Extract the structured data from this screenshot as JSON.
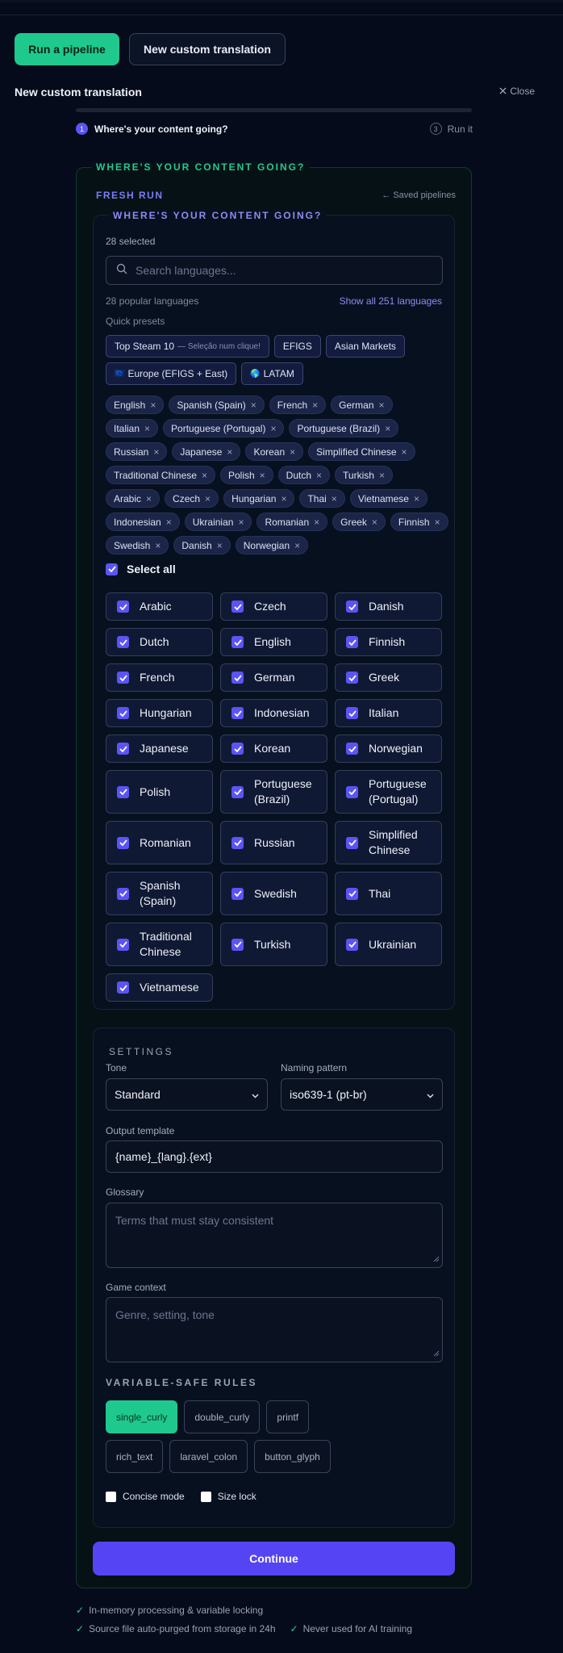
{
  "tabs": {
    "primary_label": "Run a pipeline",
    "secondary_label": "New custom translation"
  },
  "header": {
    "title": "New custom translation",
    "close_label": "Close"
  },
  "progress": {
    "fraction": 0
  },
  "steps": [
    {
      "number": "1",
      "label": "Where's your content going?",
      "active": true
    },
    {
      "number": "3",
      "label": "Run it",
      "active": false
    }
  ],
  "panel": {
    "legend": "WHERE'S YOUR CONTENT GOING?",
    "fresh_run": "FRESH RUN",
    "saved_link": "← Saved pipelines"
  },
  "languages": {
    "legend": "WHERE'S YOUR CONTENT GOING?",
    "selected_count": "28 selected",
    "search_placeholder": "Search languages...",
    "popular_count": "28 popular languages",
    "show_all": "Show all 251 languages",
    "quick_presets_label": "Quick presets",
    "presets": [
      {
        "label": "Top Steam 10",
        "sub": "— Seleção num clique!"
      },
      {
        "label": "EFIGS",
        "sub": ""
      },
      {
        "label": "Asian Markets",
        "sub": ""
      },
      {
        "label": "Europe (EFIGS + East)",
        "sub": "",
        "flag": "🇪🇺"
      },
      {
        "label": "LATAM",
        "sub": "",
        "flag": "🌎"
      }
    ],
    "chips": [
      "English",
      "Spanish (Spain)",
      "French",
      "German",
      "Italian",
      "Portuguese (Portugal)",
      "Portuguese (Brazil)",
      "Russian",
      "Japanese",
      "Korean",
      "Simplified Chinese",
      "Traditional Chinese",
      "Polish",
      "Dutch",
      "Turkish",
      "Arabic",
      "Czech",
      "Hungarian",
      "Thai",
      "Vietnamese",
      "Indonesian",
      "Ukrainian",
      "Romanian",
      "Greek",
      "Finnish",
      "Swedish",
      "Danish",
      "Norwegian"
    ],
    "chip_remove_glyph": "×",
    "select_all_label": "Select all",
    "grid": [
      {
        "label": "Arabic",
        "checked": true
      },
      {
        "label": "Czech",
        "checked": true
      },
      {
        "label": "Danish",
        "checked": true
      },
      {
        "label": "Dutch",
        "checked": true
      },
      {
        "label": "English",
        "checked": true
      },
      {
        "label": "Finnish",
        "checked": true
      },
      {
        "label": "French",
        "checked": true
      },
      {
        "label": "German",
        "checked": true
      },
      {
        "label": "Greek",
        "checked": true
      },
      {
        "label": "Hungarian",
        "checked": true
      },
      {
        "label": "Indonesian",
        "checked": true
      },
      {
        "label": "Italian",
        "checked": true
      },
      {
        "label": "Japanese",
        "checked": true
      },
      {
        "label": "Korean",
        "checked": true
      },
      {
        "label": "Norwegian",
        "checked": true
      },
      {
        "label": "Polish",
        "checked": true
      },
      {
        "label": "Portuguese (Brazil)",
        "checked": true
      },
      {
        "label": "Portuguese (Portugal)",
        "checked": true
      },
      {
        "label": "Romanian",
        "checked": true
      },
      {
        "label": "Russian",
        "checked": true
      },
      {
        "label": "Simplified Chinese",
        "checked": true
      },
      {
        "label": "Spanish (Spain)",
        "checked": true
      },
      {
        "label": "Swedish",
        "checked": true
      },
      {
        "label": "Thai",
        "checked": true
      },
      {
        "label": "Traditional Chinese",
        "checked": true
      },
      {
        "label": "Turkish",
        "checked": true
      },
      {
        "label": "Ukrainian",
        "checked": true
      },
      {
        "label": "Vietnamese",
        "checked": true
      }
    ]
  },
  "settings": {
    "title": "SETTINGS",
    "tone_label": "Tone",
    "tone_value": "Standard",
    "naming_label": "Naming pattern",
    "naming_value": "iso639-1 (pt-br)",
    "output_label": "Output template",
    "output_value": "{name}_{lang}.{ext}",
    "glossary_label": "Glossary",
    "glossary_placeholder": "Terms that must stay consistent",
    "context_label": "Game context",
    "context_placeholder": "Genre, setting, tone",
    "rules_title": "VARIABLE-SAFE RULES",
    "rules": [
      {
        "label": "single_curly",
        "active": true
      },
      {
        "label": "double_curly",
        "active": false
      },
      {
        "label": "printf",
        "active": false
      },
      {
        "label": "rich_text",
        "active": false
      },
      {
        "label": "laravel_colon",
        "active": false
      },
      {
        "label": "button_glyph",
        "active": false
      }
    ],
    "concise_label": "Concise mode",
    "concise_checked": false,
    "size_lock_label": "Size lock",
    "size_lock_checked": false
  },
  "continue_label": "Continue",
  "footer": {
    "line1": [
      "In-memory processing & variable locking"
    ],
    "line2": [
      "Source file auto-purged from storage in 24h",
      "Never used for AI training"
    ],
    "check_glyph": "✓"
  },
  "colors": {
    "accent_green": "#1fc98e",
    "accent_purple": "#5b54f5",
    "background": "#050b1a"
  }
}
